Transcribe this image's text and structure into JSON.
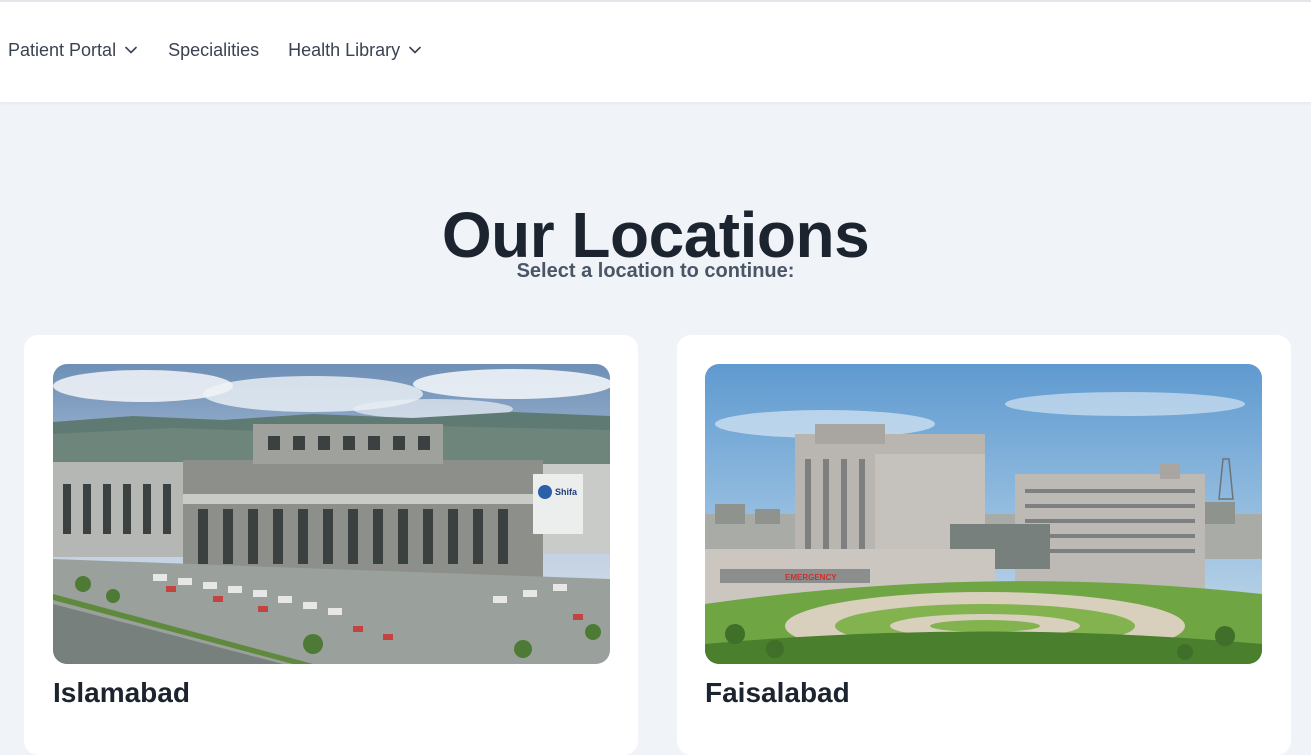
{
  "nav": {
    "items": [
      {
        "label": "Patient Portal",
        "has_dropdown": true,
        "icon": "chevron-down-icon"
      },
      {
        "label": "Specialities",
        "has_dropdown": false
      },
      {
        "label": "Health Library",
        "has_dropdown": true,
        "icon": "chevron-down-icon"
      }
    ]
  },
  "main": {
    "title": "Our Locations",
    "subtitle": "Select a location to continue:"
  },
  "locations": [
    {
      "name": "Islamabad",
      "sign_text": "Shifa"
    },
    {
      "name": "Faisalabad",
      "sign_text": "EMERGENCY"
    }
  ],
  "colors": {
    "page_background": "#f0f4f8",
    "card_background": "#ffffff",
    "heading": "#1c2430",
    "subtitle": "#4a5565",
    "nav_text": "#3a4352"
  }
}
